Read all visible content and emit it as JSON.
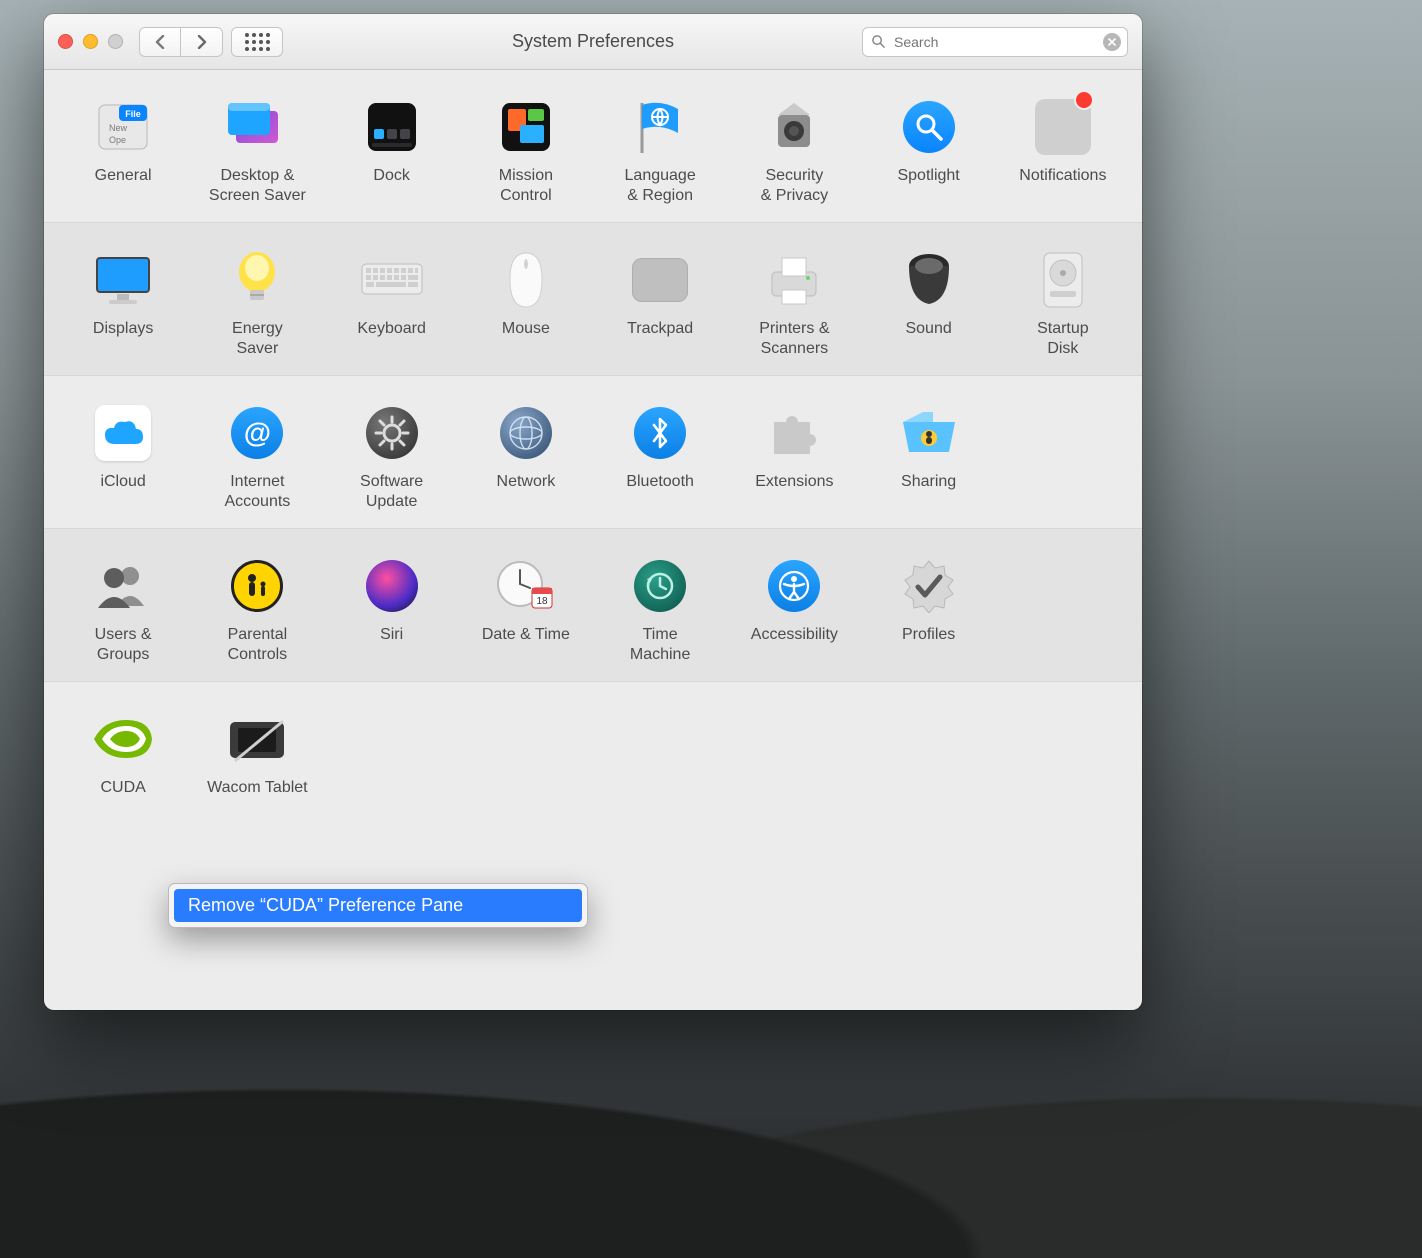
{
  "window": {
    "title": "System Preferences",
    "search_placeholder": "Search"
  },
  "rows": [
    [
      "General",
      "Desktop &\nScreen Saver",
      "Dock",
      "Mission\nControl",
      "Language\n& Region",
      "Security\n& Privacy",
      "Spotlight",
      "Notifications"
    ],
    [
      "Displays",
      "Energy\nSaver",
      "Keyboard",
      "Mouse",
      "Trackpad",
      "Printers &\nScanners",
      "Sound",
      "Startup\nDisk"
    ],
    [
      "iCloud",
      "Internet\nAccounts",
      "Software\nUpdate",
      "Network",
      "Bluetooth",
      "Extensions",
      "Sharing",
      ""
    ],
    [
      "Users &\nGroups",
      "Parental\nControls",
      "Siri",
      "Date & Time",
      "Time\nMachine",
      "Accessibility",
      "Profiles",
      ""
    ]
  ],
  "thirdparty": [
    "CUDA",
    "Wacom Tablet"
  ],
  "context_menu": {
    "item": "Remove “CUDA” Preference Pane"
  }
}
